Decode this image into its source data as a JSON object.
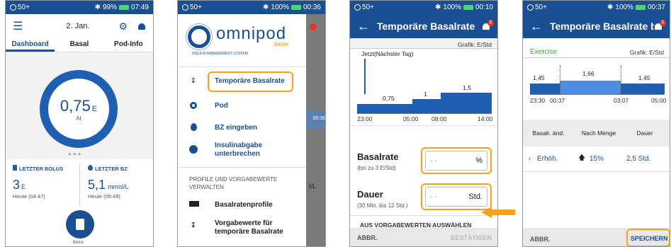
{
  "status": {
    "signal": "50+",
    "s1": {
      "bt": "✱",
      "pct": "99%",
      "time": "07:49"
    },
    "s2": {
      "pct": "100%",
      "time": "00:36"
    },
    "s3": {
      "pct": "100%",
      "time": "00:10"
    },
    "s4": {
      "pct": "100%",
      "time": "00:37"
    }
  },
  "s1": {
    "date": "2. Jan.",
    "tabs": [
      "Dashboard",
      "Basal",
      "Pod-Info"
    ],
    "dial_value": "0,75",
    "dial_unit": "E",
    "dial_sub": "AI",
    "bolus_label": "LETZTER BOLUS",
    "bz_label": "LETZTER BZ",
    "bolus_value": "3",
    "bolus_unit": "E",
    "bolus_time": "Heute (04:47)",
    "bz_value": "5,1",
    "bz_unit": "mmol/L",
    "bz_time": "Heute (05:48)",
    "bolus_btn": "Bolus"
  },
  "s2": {
    "brand": "omnipod",
    "brand_sub": "DASH",
    "tagline": "INSULIN MANAGEMENT SYSTEM",
    "menu": [
      "Temporäre Basalrate",
      "Pod",
      "BZ eingeben",
      "Insulinabgabe unterbrechen"
    ],
    "section": "PROFILE UND VORGABEWERTE VERWALTEN",
    "menu2": [
      "Basalratenprofile",
      "Vorgabewerte für temporäre Basalrate"
    ],
    "bg_time": "00:36",
    "bg_text": "I/L"
  },
  "s3": {
    "title": "Temporäre Basalrate",
    "badge": "2",
    "graph_label": "Grafik: E/Std",
    "now_label": "Jetzt(Nächster Tag)",
    "bars": [
      "0,75",
      "1",
      "1,5"
    ],
    "ticks": [
      "23:00",
      "05:00",
      "08:00",
      "14:00"
    ],
    "basal_label": "Basalrate",
    "basal_hint": "(bis zu 3 E/Std)",
    "basal_placeholder": "- -",
    "basal_unit": "%",
    "dauer_label": "Dauer",
    "dauer_hint": "(30 Min. bis 12 Std.)",
    "dauer_placeholder": "- -",
    "dauer_unit": "Std.",
    "preset_btn": "AUS VORGABEWERTEN AUSWÄHLEN",
    "cancel": "ABBR.",
    "confirm": "BESTÄTIGEN"
  },
  "s4": {
    "title": "Temporäre Basalrate be...",
    "badge": "1",
    "preset": "Exercise",
    "graph_label": "Grafik: E/Std",
    "bars": [
      "1,45",
      "1,66",
      "1,45"
    ],
    "ticks": [
      "23:30",
      "00:37",
      "03:07",
      "05:00"
    ],
    "headers": [
      "Basalr. änd.",
      "Nach Menge",
      "Dauer"
    ],
    "row": [
      "Erhöh.",
      "15%",
      "2,5 Std."
    ],
    "cancel": "ABBR.",
    "save": "SPEICHERN"
  },
  "colors": {
    "primary": "#1b4f93",
    "bar": "#1f5fb2",
    "highlight": "#f5a21b",
    "exercise": "#3aa83a"
  }
}
